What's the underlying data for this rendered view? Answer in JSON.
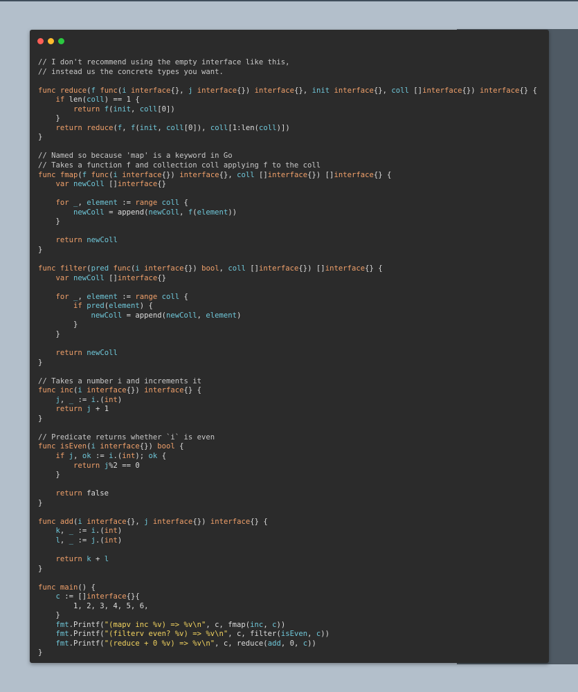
{
  "window": {
    "controls": [
      "close",
      "minimize",
      "maximize"
    ],
    "colors": {
      "close": "#fe5f57",
      "minimize": "#febb2e",
      "maximize": "#2bc840",
      "background": "#2b2b2b"
    }
  },
  "code": {
    "language": "Go",
    "lines": [
      [
        [
          "c",
          "// I don't recommend using the empty interface like this,"
        ]
      ],
      [
        [
          "c",
          "// instead us the concrete types you want."
        ]
      ],
      [],
      [
        [
          "k",
          "func "
        ],
        [
          "f",
          "reduce"
        ],
        [
          "p",
          "("
        ],
        [
          "i",
          "f"
        ],
        [
          "p",
          " "
        ],
        [
          "k",
          "func"
        ],
        [
          "p",
          "("
        ],
        [
          "i",
          "i"
        ],
        [
          "p",
          " "
        ],
        [
          "t",
          "interface"
        ],
        [
          "p",
          "{}, "
        ],
        [
          "i",
          "j"
        ],
        [
          "p",
          " "
        ],
        [
          "t",
          "interface"
        ],
        [
          "p",
          "{}) "
        ],
        [
          "t",
          "interface"
        ],
        [
          "p",
          "{}, "
        ],
        [
          "i",
          "init"
        ],
        [
          "p",
          " "
        ],
        [
          "t",
          "interface"
        ],
        [
          "p",
          "{}, "
        ],
        [
          "i",
          "coll"
        ],
        [
          "p",
          " []"
        ],
        [
          "t",
          "interface"
        ],
        [
          "p",
          "{}) "
        ],
        [
          "t",
          "interface"
        ],
        [
          "p",
          "{} {"
        ]
      ],
      [
        [
          "p",
          "    "
        ],
        [
          "k",
          "if"
        ],
        [
          "p",
          " len("
        ],
        [
          "i",
          "coll"
        ],
        [
          "p",
          ") == 1 {"
        ]
      ],
      [
        [
          "p",
          "        "
        ],
        [
          "k",
          "return"
        ],
        [
          "p",
          " "
        ],
        [
          "i",
          "f"
        ],
        [
          "p",
          "("
        ],
        [
          "i",
          "init"
        ],
        [
          "p",
          ", "
        ],
        [
          "i",
          "coll"
        ],
        [
          "p",
          "[0])"
        ]
      ],
      [
        [
          "p",
          "    }"
        ]
      ],
      [
        [
          "p",
          "    "
        ],
        [
          "k",
          "return"
        ],
        [
          "p",
          " "
        ],
        [
          "f",
          "reduce"
        ],
        [
          "p",
          "("
        ],
        [
          "i",
          "f"
        ],
        [
          "p",
          ", "
        ],
        [
          "i",
          "f"
        ],
        [
          "p",
          "("
        ],
        [
          "i",
          "init"
        ],
        [
          "p",
          ", "
        ],
        [
          "i",
          "coll"
        ],
        [
          "p",
          "[0]), "
        ],
        [
          "i",
          "coll"
        ],
        [
          "p",
          "[1:len("
        ],
        [
          "i",
          "coll"
        ],
        [
          "p",
          ")])"
        ]
      ],
      [
        [
          "p",
          "}"
        ]
      ],
      [],
      [
        [
          "c",
          "// Named so because 'map' is a keyword in Go"
        ]
      ],
      [
        [
          "c",
          "// Takes a function f and collection coll applying f to the coll"
        ]
      ],
      [
        [
          "k",
          "func "
        ],
        [
          "f",
          "fmap"
        ],
        [
          "p",
          "("
        ],
        [
          "i",
          "f"
        ],
        [
          "p",
          " "
        ],
        [
          "k",
          "func"
        ],
        [
          "p",
          "("
        ],
        [
          "i",
          "i"
        ],
        [
          "p",
          " "
        ],
        [
          "t",
          "interface"
        ],
        [
          "p",
          "{}) "
        ],
        [
          "t",
          "interface"
        ],
        [
          "p",
          "{}, "
        ],
        [
          "i",
          "coll"
        ],
        [
          "p",
          " []"
        ],
        [
          "t",
          "interface"
        ],
        [
          "p",
          "{}) []"
        ],
        [
          "t",
          "interface"
        ],
        [
          "p",
          "{} {"
        ]
      ],
      [
        [
          "p",
          "    "
        ],
        [
          "k",
          "var"
        ],
        [
          "p",
          " "
        ],
        [
          "i",
          "newColl"
        ],
        [
          "p",
          " []"
        ],
        [
          "t",
          "interface"
        ],
        [
          "p",
          "{}"
        ]
      ],
      [],
      [
        [
          "p",
          "    "
        ],
        [
          "k",
          "for"
        ],
        [
          "p",
          " "
        ],
        [
          "i",
          "_"
        ],
        [
          "p",
          ", "
        ],
        [
          "i",
          "element"
        ],
        [
          "p",
          " := "
        ],
        [
          "k",
          "range"
        ],
        [
          "p",
          " "
        ],
        [
          "i",
          "coll"
        ],
        [
          "p",
          " {"
        ]
      ],
      [
        [
          "p",
          "        "
        ],
        [
          "i",
          "newColl"
        ],
        [
          "p",
          " = append("
        ],
        [
          "i",
          "newColl"
        ],
        [
          "p",
          ", "
        ],
        [
          "i",
          "f"
        ],
        [
          "p",
          "("
        ],
        [
          "i",
          "element"
        ],
        [
          "p",
          "))"
        ]
      ],
      [
        [
          "p",
          "    }"
        ]
      ],
      [],
      [
        [
          "p",
          "    "
        ],
        [
          "k",
          "return"
        ],
        [
          "p",
          " "
        ],
        [
          "i",
          "newColl"
        ]
      ],
      [
        [
          "p",
          "}"
        ]
      ],
      [],
      [
        [
          "k",
          "func "
        ],
        [
          "f",
          "filter"
        ],
        [
          "p",
          "("
        ],
        [
          "i",
          "pred"
        ],
        [
          "p",
          " "
        ],
        [
          "k",
          "func"
        ],
        [
          "p",
          "("
        ],
        [
          "i",
          "i"
        ],
        [
          "p",
          " "
        ],
        [
          "t",
          "interface"
        ],
        [
          "p",
          "{}) "
        ],
        [
          "t",
          "bool"
        ],
        [
          "p",
          ", "
        ],
        [
          "i",
          "coll"
        ],
        [
          "p",
          " []"
        ],
        [
          "t",
          "interface"
        ],
        [
          "p",
          "{}) []"
        ],
        [
          "t",
          "interface"
        ],
        [
          "p",
          "{} {"
        ]
      ],
      [
        [
          "p",
          "    "
        ],
        [
          "k",
          "var"
        ],
        [
          "p",
          " "
        ],
        [
          "i",
          "newColl"
        ],
        [
          "p",
          " []"
        ],
        [
          "t",
          "interface"
        ],
        [
          "p",
          "{}"
        ]
      ],
      [],
      [
        [
          "p",
          "    "
        ],
        [
          "k",
          "for"
        ],
        [
          "p",
          " "
        ],
        [
          "i",
          "_"
        ],
        [
          "p",
          ", "
        ],
        [
          "i",
          "element"
        ],
        [
          "p",
          " := "
        ],
        [
          "k",
          "range"
        ],
        [
          "p",
          " "
        ],
        [
          "i",
          "coll"
        ],
        [
          "p",
          " {"
        ]
      ],
      [
        [
          "p",
          "        "
        ],
        [
          "k",
          "if"
        ],
        [
          "p",
          " "
        ],
        [
          "i",
          "pred"
        ],
        [
          "p",
          "("
        ],
        [
          "i",
          "element"
        ],
        [
          "p",
          ") {"
        ]
      ],
      [
        [
          "p",
          "            "
        ],
        [
          "i",
          "newColl"
        ],
        [
          "p",
          " = append("
        ],
        [
          "i",
          "newColl"
        ],
        [
          "p",
          ", "
        ],
        [
          "i",
          "element"
        ],
        [
          "p",
          ")"
        ]
      ],
      [
        [
          "p",
          "        }"
        ]
      ],
      [
        [
          "p",
          "    }"
        ]
      ],
      [],
      [
        [
          "p",
          "    "
        ],
        [
          "k",
          "return"
        ],
        [
          "p",
          " "
        ],
        [
          "i",
          "newColl"
        ]
      ],
      [
        [
          "p",
          "}"
        ]
      ],
      [],
      [
        [
          "c",
          "// Takes a number i and increments it"
        ]
      ],
      [
        [
          "k",
          "func "
        ],
        [
          "f",
          "inc"
        ],
        [
          "p",
          "("
        ],
        [
          "i",
          "i"
        ],
        [
          "p",
          " "
        ],
        [
          "t",
          "interface"
        ],
        [
          "p",
          "{}) "
        ],
        [
          "t",
          "interface"
        ],
        [
          "p",
          "{} {"
        ]
      ],
      [
        [
          "p",
          "    "
        ],
        [
          "i",
          "j"
        ],
        [
          "p",
          ", "
        ],
        [
          "i",
          "_"
        ],
        [
          "p",
          " := "
        ],
        [
          "i",
          "i"
        ],
        [
          "p",
          ".("
        ],
        [
          "t",
          "int"
        ],
        [
          "p",
          ")"
        ]
      ],
      [
        [
          "p",
          "    "
        ],
        [
          "k",
          "return"
        ],
        [
          "p",
          " "
        ],
        [
          "i",
          "j"
        ],
        [
          "p",
          " + 1"
        ]
      ],
      [
        [
          "p",
          "}"
        ]
      ],
      [],
      [
        [
          "c",
          "// Predicate returns whether `i` is even"
        ]
      ],
      [
        [
          "k",
          "func "
        ],
        [
          "f",
          "isEven"
        ],
        [
          "p",
          "("
        ],
        [
          "i",
          "i"
        ],
        [
          "p",
          " "
        ],
        [
          "t",
          "interface"
        ],
        [
          "p",
          "{}) "
        ],
        [
          "t",
          "bool"
        ],
        [
          "p",
          " {"
        ]
      ],
      [
        [
          "p",
          "    "
        ],
        [
          "k",
          "if"
        ],
        [
          "p",
          " "
        ],
        [
          "i",
          "j"
        ],
        [
          "p",
          ", "
        ],
        [
          "i",
          "ok"
        ],
        [
          "p",
          " := "
        ],
        [
          "i",
          "i"
        ],
        [
          "p",
          ".("
        ],
        [
          "t",
          "int"
        ],
        [
          "p",
          "); "
        ],
        [
          "i",
          "ok"
        ],
        [
          "p",
          " {"
        ]
      ],
      [
        [
          "p",
          "        "
        ],
        [
          "k",
          "return"
        ],
        [
          "p",
          " "
        ],
        [
          "i",
          "j"
        ],
        [
          "p",
          "%2 == 0"
        ]
      ],
      [
        [
          "p",
          "    }"
        ]
      ],
      [],
      [
        [
          "p",
          "    "
        ],
        [
          "k",
          "return"
        ],
        [
          "p",
          " false"
        ]
      ],
      [
        [
          "p",
          "}"
        ]
      ],
      [],
      [
        [
          "k",
          "func "
        ],
        [
          "f",
          "add"
        ],
        [
          "p",
          "("
        ],
        [
          "i",
          "i"
        ],
        [
          "p",
          " "
        ],
        [
          "t",
          "interface"
        ],
        [
          "p",
          "{}, "
        ],
        [
          "i",
          "j"
        ],
        [
          "p",
          " "
        ],
        [
          "t",
          "interface"
        ],
        [
          "p",
          "{}) "
        ],
        [
          "t",
          "interface"
        ],
        [
          "p",
          "{} {"
        ]
      ],
      [
        [
          "p",
          "    "
        ],
        [
          "i",
          "k"
        ],
        [
          "p",
          ", "
        ],
        [
          "i",
          "_"
        ],
        [
          "p",
          " := "
        ],
        [
          "i",
          "i"
        ],
        [
          "p",
          ".("
        ],
        [
          "t",
          "int"
        ],
        [
          "p",
          ")"
        ]
      ],
      [
        [
          "p",
          "    "
        ],
        [
          "i",
          "l"
        ],
        [
          "p",
          ", "
        ],
        [
          "i",
          "_"
        ],
        [
          "p",
          " := "
        ],
        [
          "i",
          "j"
        ],
        [
          "p",
          ".("
        ],
        [
          "t",
          "int"
        ],
        [
          "p",
          ")"
        ]
      ],
      [],
      [
        [
          "p",
          "    "
        ],
        [
          "k",
          "return"
        ],
        [
          "p",
          " "
        ],
        [
          "i",
          "k"
        ],
        [
          "p",
          " + "
        ],
        [
          "i",
          "l"
        ]
      ],
      [
        [
          "p",
          "}"
        ]
      ],
      [],
      [
        [
          "k",
          "func "
        ],
        [
          "f",
          "main"
        ],
        [
          "p",
          "() {"
        ]
      ],
      [
        [
          "p",
          "    "
        ],
        [
          "i",
          "c"
        ],
        [
          "p",
          " := []"
        ],
        [
          "t",
          "interface"
        ],
        [
          "p",
          "{}{"
        ]
      ],
      [
        [
          "p",
          "        1, 2, 3, 4, 5, 6,"
        ]
      ],
      [
        [
          "p",
          "    }"
        ]
      ],
      [
        [
          "p",
          "    "
        ],
        [
          "i",
          "fmt"
        ],
        [
          "p",
          ".Printf("
        ],
        [
          "s",
          "\"(mapv inc %v) => %v\\n\""
        ],
        [
          "p",
          ", c, fmap("
        ],
        [
          "i",
          "inc"
        ],
        [
          "p",
          ", "
        ],
        [
          "i",
          "c"
        ],
        [
          "p",
          "))"
        ]
      ],
      [
        [
          "p",
          "    "
        ],
        [
          "i",
          "fmt"
        ],
        [
          "p",
          ".Printf("
        ],
        [
          "s",
          "\"(filterv even? %v) => %v\\n\""
        ],
        [
          "p",
          ", c, filter("
        ],
        [
          "i",
          "isEven"
        ],
        [
          "p",
          ", "
        ],
        [
          "i",
          "c"
        ],
        [
          "p",
          "))"
        ]
      ],
      [
        [
          "p",
          "    "
        ],
        [
          "i",
          "fmt"
        ],
        [
          "p",
          ".Printf("
        ],
        [
          "s",
          "\"(reduce + 0 %v) => %v\\n\""
        ],
        [
          "p",
          ", c, reduce("
        ],
        [
          "i",
          "add"
        ],
        [
          "p",
          ", 0, "
        ],
        [
          "i",
          "c"
        ],
        [
          "p",
          "))"
        ]
      ],
      [
        [
          "p",
          "}"
        ]
      ]
    ]
  }
}
